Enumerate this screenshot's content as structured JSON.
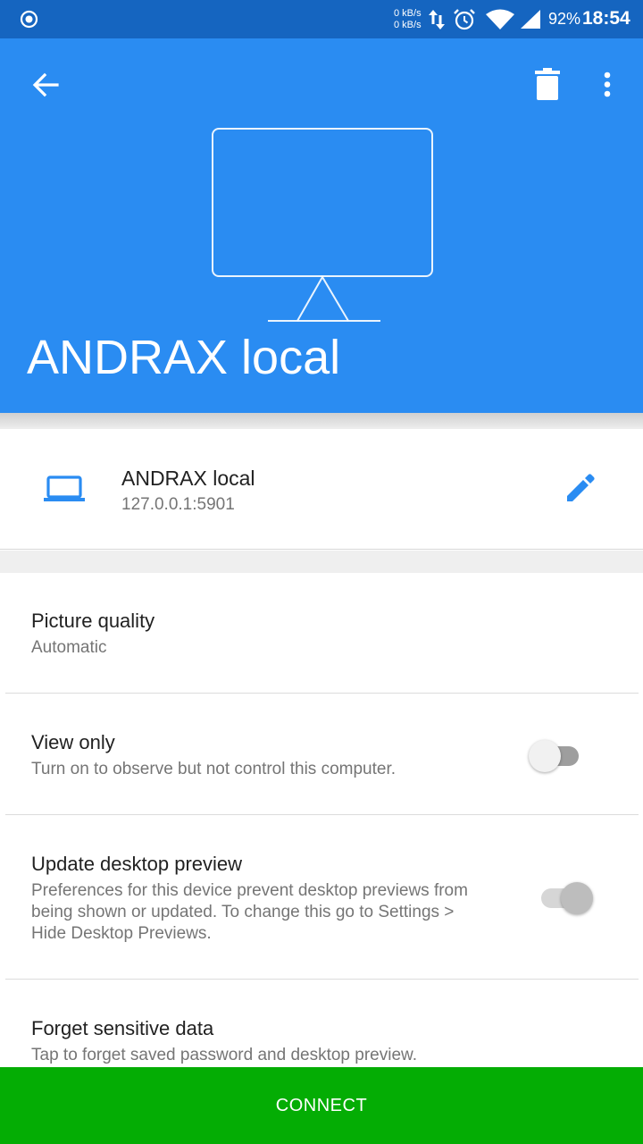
{
  "status_bar": {
    "net_up": "0 kB/s",
    "net_down": "0 kB/s",
    "battery": "92%",
    "time": "18:54",
    "icons": [
      "record-icon",
      "data-arrows-icon",
      "alarm-icon",
      "wifi-icon",
      "signal-icon"
    ]
  },
  "header": {
    "title": "ANDRAX local",
    "background_color": "#2a8cf2",
    "icons": [
      "back-arrow-icon",
      "delete-icon",
      "more-vert-icon",
      "monitor-icon"
    ]
  },
  "device": {
    "name": "ANDRAX local",
    "address": "127.0.0.1:5901",
    "icons": [
      "laptop-icon",
      "edit-pencil-icon"
    ],
    "accent_color": "#2a8cf2"
  },
  "settings": [
    {
      "title": "Picture quality",
      "subtitle": "Automatic"
    },
    {
      "title": "View only",
      "subtitle": "Turn on to observe but not control this computer.",
      "toggle_on": false
    },
    {
      "title": "Update desktop preview",
      "subtitle_lines": [
        "Preferences for this device prevent desktop previews from",
        "being shown or updated. To change this go to Settings >",
        "Hide Desktop Previews."
      ],
      "toggle_on": true,
      "toggle_disabled": true
    },
    {
      "title": "Forget sensitive data",
      "subtitle": "Tap to forget saved password and desktop preview."
    }
  ],
  "connect": {
    "label": "CONNECT",
    "color": "#04ad04"
  }
}
